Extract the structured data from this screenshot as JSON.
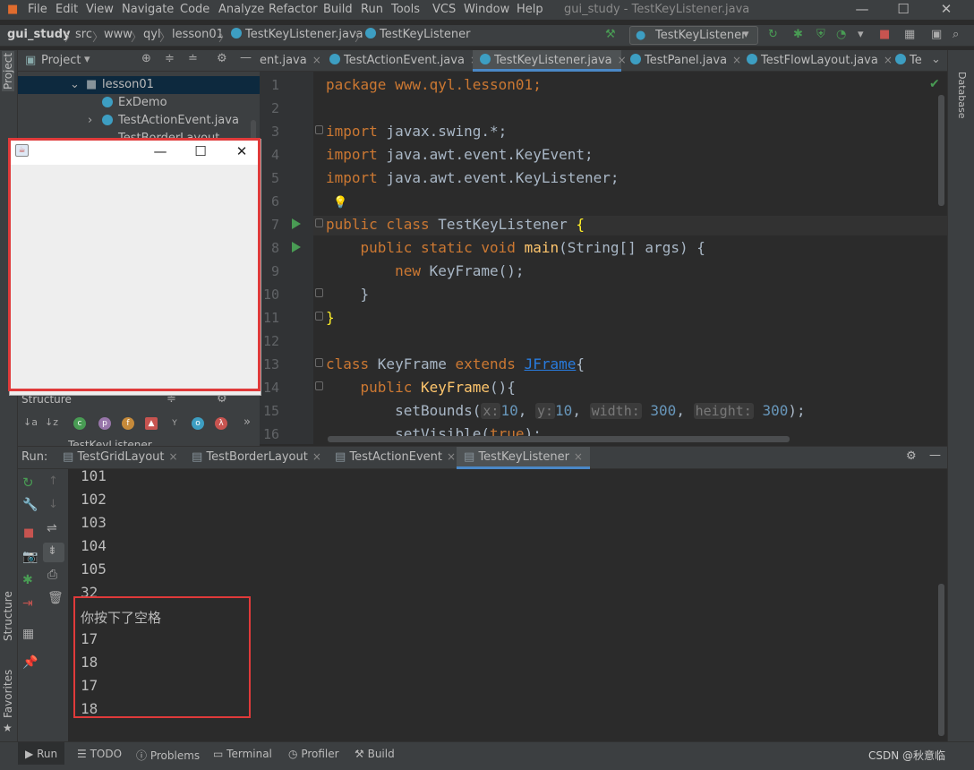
{
  "menu": [
    "File",
    "Edit",
    "View",
    "Navigate",
    "Code",
    "Analyze",
    "Refactor",
    "Build",
    "Run",
    "Tools",
    "VCS",
    "Window",
    "Help"
  ],
  "window_title": "gui_study - TestKeyListener.java",
  "breadcrumb": [
    "gui_study",
    "src",
    "www",
    "qyl",
    "lesson01",
    "TestKeyListener.java",
    "TestKeyListener"
  ],
  "run_config": "TestKeyListener",
  "project_panel": {
    "title": "Project",
    "tree": [
      {
        "label": "lesson01",
        "kind": "folder"
      },
      {
        "label": "ExDemo",
        "kind": "class"
      },
      {
        "label": "TestActionEvent.java",
        "kind": "class"
      },
      {
        "label": "TestBorderLayout",
        "kind": "class"
      }
    ]
  },
  "structure_panel": {
    "title": "Structure",
    "item": "TestKeyListener"
  },
  "editor_tabs": [
    {
      "label": "ent.java",
      "active": false
    },
    {
      "label": "TestActionEvent.java",
      "active": false
    },
    {
      "label": "TestKeyListener.java",
      "active": true
    },
    {
      "label": "TestPanel.java",
      "active": false
    },
    {
      "label": "TestFlowLayout.java",
      "active": false
    },
    {
      "label": "Te",
      "active": false
    }
  ],
  "code": {
    "line_numbers": [
      "1",
      "2",
      "3",
      "4",
      "5",
      "6",
      "7",
      "8",
      "9",
      "10",
      "11",
      "12",
      "13",
      "14",
      "15",
      "16"
    ],
    "l1": "package www.qyl.lesson01;",
    "l3a": "import",
    "l3b": " javax.swing.*;",
    "l4a": "import",
    "l4b": " java.awt.event.KeyEvent;",
    "l5a": "import",
    "l5b": " java.awt.event.KeyListener;",
    "l7a": "public class ",
    "l7b": "TestKeyListener ",
    "l7c": "{",
    "l8a": "    public static void ",
    "l8b": "main",
    "l8c": "(String[] args) {",
    "l9a": "        new ",
    "l9b": "KeyFrame();",
    "l10": "    }",
    "l11": "}",
    "l13a": "class ",
    "l13b": "KeyFrame ",
    "l13c": "extends ",
    "l13d": "JFrame",
    "l13e": "{",
    "l14a": "    public ",
    "l14b": "KeyFrame",
    "l14c": "(){",
    "l15a": "        setBounds(",
    "l15h1": "x:",
    "l15v1": "10",
    "l15h2": "y:",
    "l15v2": "10",
    "l15h3": "width:",
    "l15v3": "300",
    "l15h4": "height:",
    "l15v4": "300",
    "l15e": ");",
    "l16a": "        setVisible(",
    "l16b": "true",
    "l16c": ");"
  },
  "run_panel": {
    "label": "Run:",
    "tabs": [
      "TestGridLayout",
      "TestBorderLayout",
      "TestActionEvent",
      "TestKeyListener"
    ],
    "active_tab": "TestKeyListener",
    "console": [
      "101",
      "102",
      "103",
      "104",
      "105",
      "32",
      "你按下了空格",
      "17",
      "18",
      "17",
      "18"
    ]
  },
  "bottom_bar": [
    "Run",
    "TODO",
    "Problems",
    "Terminal",
    "Profiler",
    "Build"
  ],
  "side_labels": {
    "project": "Project",
    "structure": "Structure",
    "favorites": "Favorites",
    "database": "Database"
  },
  "watermark": "CSDN @秋意临",
  "colors": {
    "accent": "#4a88c7",
    "highlight_box": "#e03a3a",
    "run_green": "#499c54"
  }
}
